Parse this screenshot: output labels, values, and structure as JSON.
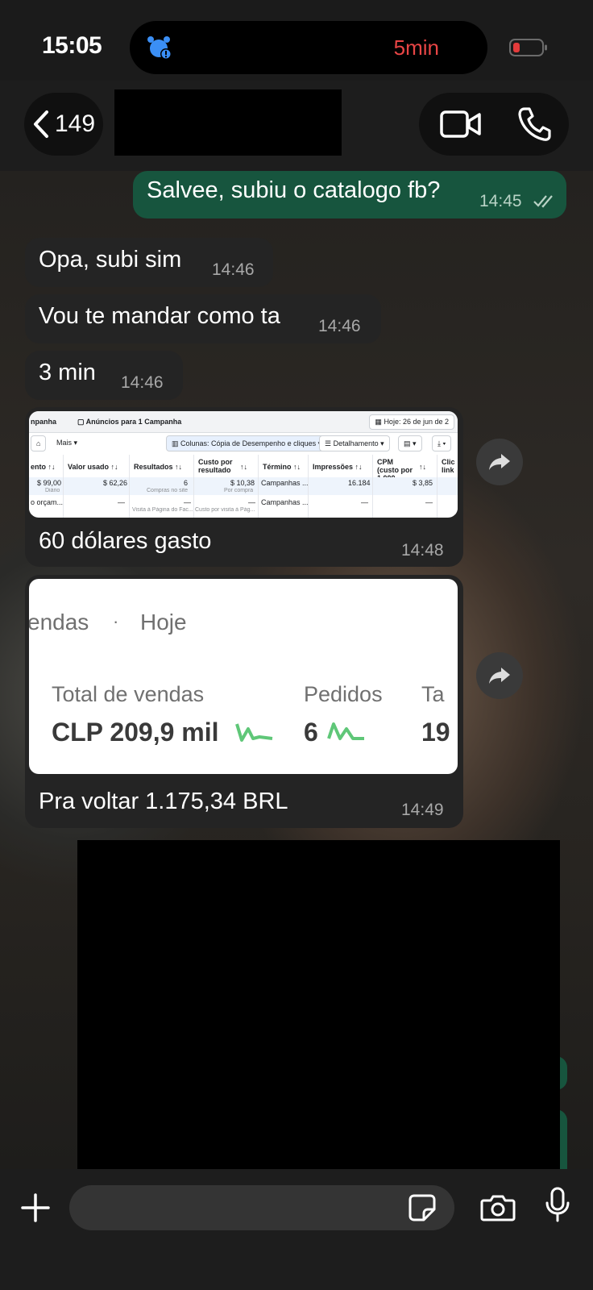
{
  "status_bar": {
    "time": "15:05",
    "timer": "5min"
  },
  "header": {
    "back_count": "149"
  },
  "messages": [
    {
      "text": "Salvee, subiu o catalogo fb?",
      "time": "14:45"
    },
    {
      "text": "Opa, subi sim",
      "time": "14:46"
    },
    {
      "text": "Vou te mandar como ta",
      "time": "14:46"
    },
    {
      "text": "3 min",
      "time": "14:46"
    },
    {
      "text": "60 dólares gasto",
      "time": "14:48"
    },
    {
      "text": "Pra voltar 1.175,34 BRL",
      "time": "14:49"
    }
  ],
  "ads_screenshot": {
    "tab_campaign": "npanha",
    "tab_ads": "Anúncios para 1 Campanha",
    "date": "Hoje: 26 de jun de 2",
    "more": "Mais",
    "columns_button": "Colunas: Cópia de Desempenho e cliques",
    "breakdown_button": "Detalhamento",
    "headers": [
      "ento ↑↓",
      "Valor usado ↑↓",
      "Resultados ↑↓",
      "Custo por resultado",
      "↑↓",
      "Término ↑↓",
      "Impressões ↑↓",
      "CPM (custo por 1.000...",
      "↑↓",
      "Clic link"
    ],
    "row1": [
      "$ 99,00",
      "$ 62,26",
      "6",
      "$ 10,38",
      "Campanhas ...",
      "16.184",
      "$ 3,85"
    ],
    "row1_sub": [
      "Diário",
      "Compras no site",
      "Por compra"
    ],
    "row2": [
      "o orçam...",
      "—",
      "—",
      "—",
      "Campanhas ...",
      "—",
      "—"
    ],
    "row2_sub": [
      "Visita à Página do Fac...",
      "Custo por visita à Pág..."
    ]
  },
  "sales_screenshot": {
    "tab_sales": "endas",
    "tab_today": "Hoje",
    "total_label": "Total de vendas",
    "total_value": "CLP 209,9 mil",
    "orders_label": "Pedidos",
    "orders_value": "6",
    "next_label": "Ta",
    "next_value": "19"
  },
  "composer": {
    "placeholder": ""
  },
  "colors": {
    "outgoing_bubble": "#17553e",
    "incoming_bubble": "#242424",
    "alarm": "#3b8ff5",
    "timer": "#e84545"
  }
}
